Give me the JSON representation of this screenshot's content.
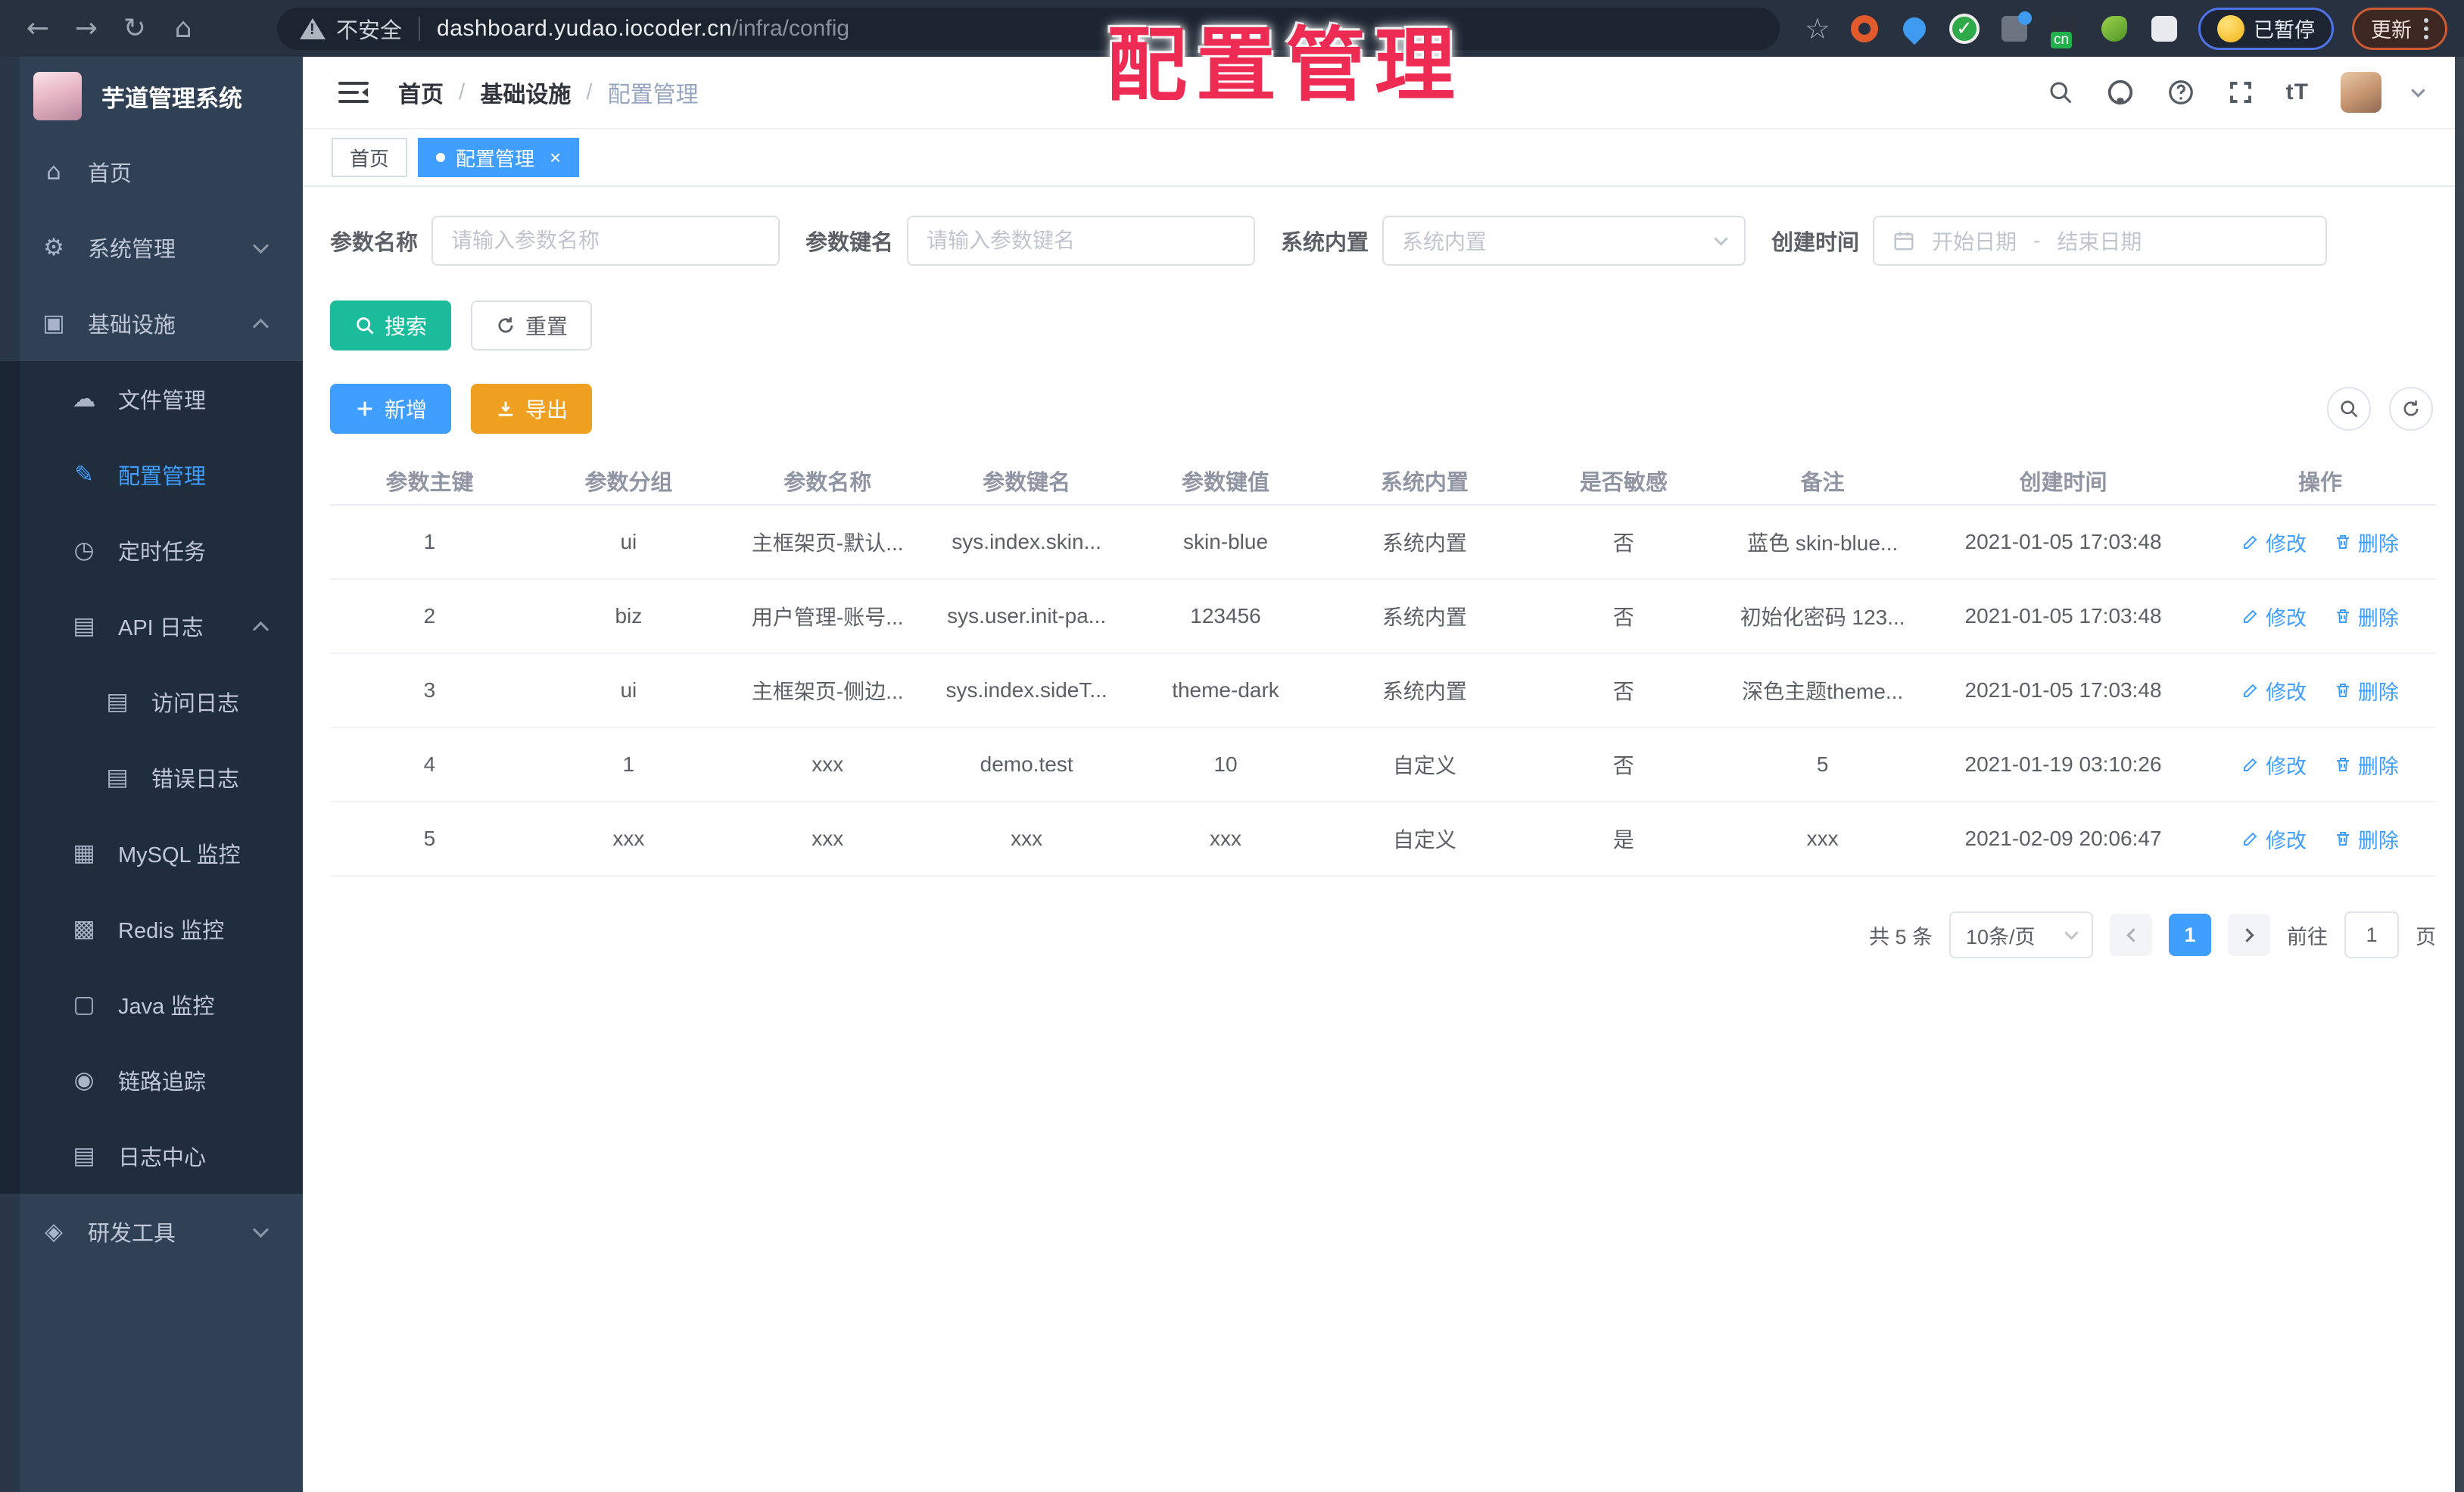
{
  "colors": {
    "accent": "#409eff",
    "search_button": "#1abc9c",
    "export_button": "#f0a020",
    "overlay_red": "#ee2b52",
    "sidebar_bg": "#304156",
    "submenu_bg": "#1f2d3d"
  },
  "browser": {
    "icons": {
      "back": "←",
      "forward": "→",
      "reload": "↻",
      "home": "⌂",
      "star": "☆"
    },
    "security_label": "不安全",
    "url_host": "dashboard.yudao.iocoder.cn",
    "url_path": "/infra/config",
    "ext_cn_badge": "cn",
    "paused_label": "已暂停",
    "update_label": "更新"
  },
  "overlay_title": "配置管理",
  "sidebar": {
    "logo_title": "芋道管理系统",
    "items": [
      {
        "label": "首页",
        "glyph": "⌂"
      },
      {
        "label": "系统管理",
        "glyph": "⚙"
      },
      {
        "label": "基础设施",
        "glyph": "▣"
      },
      {
        "label": "文件管理",
        "glyph": "☁"
      },
      {
        "label": "配置管理",
        "glyph": "✎"
      },
      {
        "label": "定时任务",
        "glyph": "◷"
      },
      {
        "label": "API 日志",
        "glyph": "▤"
      },
      {
        "label": "访问日志",
        "glyph": "▤"
      },
      {
        "label": "错误日志",
        "glyph": "▤"
      },
      {
        "label": "MySQL 监控",
        "glyph": "▦"
      },
      {
        "label": "Redis 监控",
        "glyph": "▩"
      },
      {
        "label": "Java 监控",
        "glyph": "▢"
      },
      {
        "label": "链路追踪",
        "glyph": "◉"
      },
      {
        "label": "日志中心",
        "glyph": "▤"
      },
      {
        "label": "研发工具",
        "glyph": "◈"
      }
    ]
  },
  "header": {
    "breadcrumb": {
      "home": "首页",
      "section": "基础设施",
      "current": "配置管理",
      "separator": "/"
    },
    "font_size_icon": "tT"
  },
  "tabs": {
    "home": "首页",
    "current": "配置管理",
    "close": "×"
  },
  "filters": {
    "name_label": "参数名称",
    "name_placeholder": "请输入参数名称",
    "key_label": "参数键名",
    "key_placeholder": "请输入参数键名",
    "type_label": "系统内置",
    "type_placeholder": "系统内置",
    "date_label": "创建时间",
    "date_start": "开始日期",
    "date_separator": "-",
    "date_end": "结束日期",
    "search_label": "搜索",
    "reset_label": "重置"
  },
  "toolbar": {
    "add_label": "新增",
    "export_label": "导出"
  },
  "table": {
    "columns": [
      "参数主键",
      "参数分组",
      "参数名称",
      "参数键名",
      "参数键值",
      "系统内置",
      "是否敏感",
      "备注",
      "创建时间",
      "操作"
    ],
    "edit_label": "修改",
    "delete_label": "删除",
    "rows": [
      {
        "id": "1",
        "group": "ui",
        "name": "主框架页-默认...",
        "key": "sys.index.skin...",
        "value": "skin-blue",
        "builtin": "系统内置",
        "sensitive": "否",
        "remark": "蓝色 skin-blue...",
        "created": "2021-01-05 17:03:48"
      },
      {
        "id": "2",
        "group": "biz",
        "name": "用户管理-账号...",
        "key": "sys.user.init-pa...",
        "value": "123456",
        "builtin": "系统内置",
        "sensitive": "否",
        "remark": "初始化密码 123...",
        "created": "2021-01-05 17:03:48"
      },
      {
        "id": "3",
        "group": "ui",
        "name": "主框架页-侧边...",
        "key": "sys.index.sideT...",
        "value": "theme-dark",
        "builtin": "系统内置",
        "sensitive": "否",
        "remark": "深色主题theme...",
        "created": "2021-01-05 17:03:48"
      },
      {
        "id": "4",
        "group": "1",
        "name": "xxx",
        "key": "demo.test",
        "value": "10",
        "builtin": "自定义",
        "sensitive": "否",
        "remark": "5",
        "created": "2021-01-19 03:10:26"
      },
      {
        "id": "5",
        "group": "xxx",
        "name": "xxx",
        "key": "xxx",
        "value": "xxx",
        "builtin": "自定义",
        "sensitive": "是",
        "remark": "xxx",
        "created": "2021-02-09 20:06:47"
      }
    ]
  },
  "pagination": {
    "total": "共 5 条",
    "page_size": "10条/页",
    "page": "1",
    "goto_label": "前往",
    "goto_value": "1",
    "unit": "页"
  }
}
